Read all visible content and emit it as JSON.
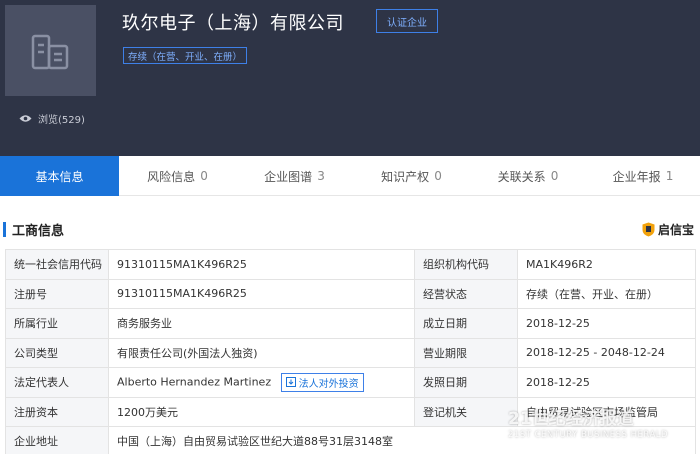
{
  "header": {
    "company_name": "玖尔电子（上海）有限公司",
    "certify_label": "认证企业",
    "status_tag": "存续（在营、开业、在册）",
    "views_label": "浏览(529)"
  },
  "tabs": [
    {
      "label": "基本信息",
      "count": ""
    },
    {
      "label": "风险信息",
      "count": "0"
    },
    {
      "label": "企业图谱",
      "count": "3"
    },
    {
      "label": "知识产权",
      "count": "0"
    },
    {
      "label": "关联关系",
      "count": "0"
    },
    {
      "label": "企业年报",
      "count": "1"
    }
  ],
  "section": {
    "title": "工商信息",
    "brand": "启信宝"
  },
  "table": {
    "rows": [
      {
        "l1": "统一社会信用代码",
        "v1": "91310115MA1K496R25",
        "l2": "组织机构代码",
        "v2": "MA1K496R2"
      },
      {
        "l1": "注册号",
        "v1": "91310115MA1K496R25",
        "l2": "经营状态",
        "v2": "存续（在营、开业、在册）"
      },
      {
        "l1": "所属行业",
        "v1": "商务服务业",
        "l2": "成立日期",
        "v2": "2018-12-25"
      },
      {
        "l1": "公司类型",
        "v1": "有限责任公司(外国法人独资)",
        "l2": "营业期限",
        "v2": "2018-12-25 - 2048-12-24"
      },
      {
        "l1": "法定代表人",
        "v1": "Alberto Hernandez Martinez",
        "l2": "发照日期",
        "v2": "2018-12-25"
      },
      {
        "l1": "注册资本",
        "v1": "1200万美元",
        "l2": "登记机关",
        "v2": "自由贸易试验区市场监管局"
      },
      {
        "l1": "企业地址",
        "v1": "中国（上海）自由贸易试验区世纪大道88号31层3148室"
      }
    ],
    "invest_label": "法人对外投资"
  },
  "watermark": {
    "main": "21世纪经济报道",
    "sub": "21ST CENTURY BUSINESS HERALD"
  },
  "colors": {
    "header_bg": "#2e3446",
    "accent": "#1a73d9",
    "tag_border": "#3e80e8"
  }
}
